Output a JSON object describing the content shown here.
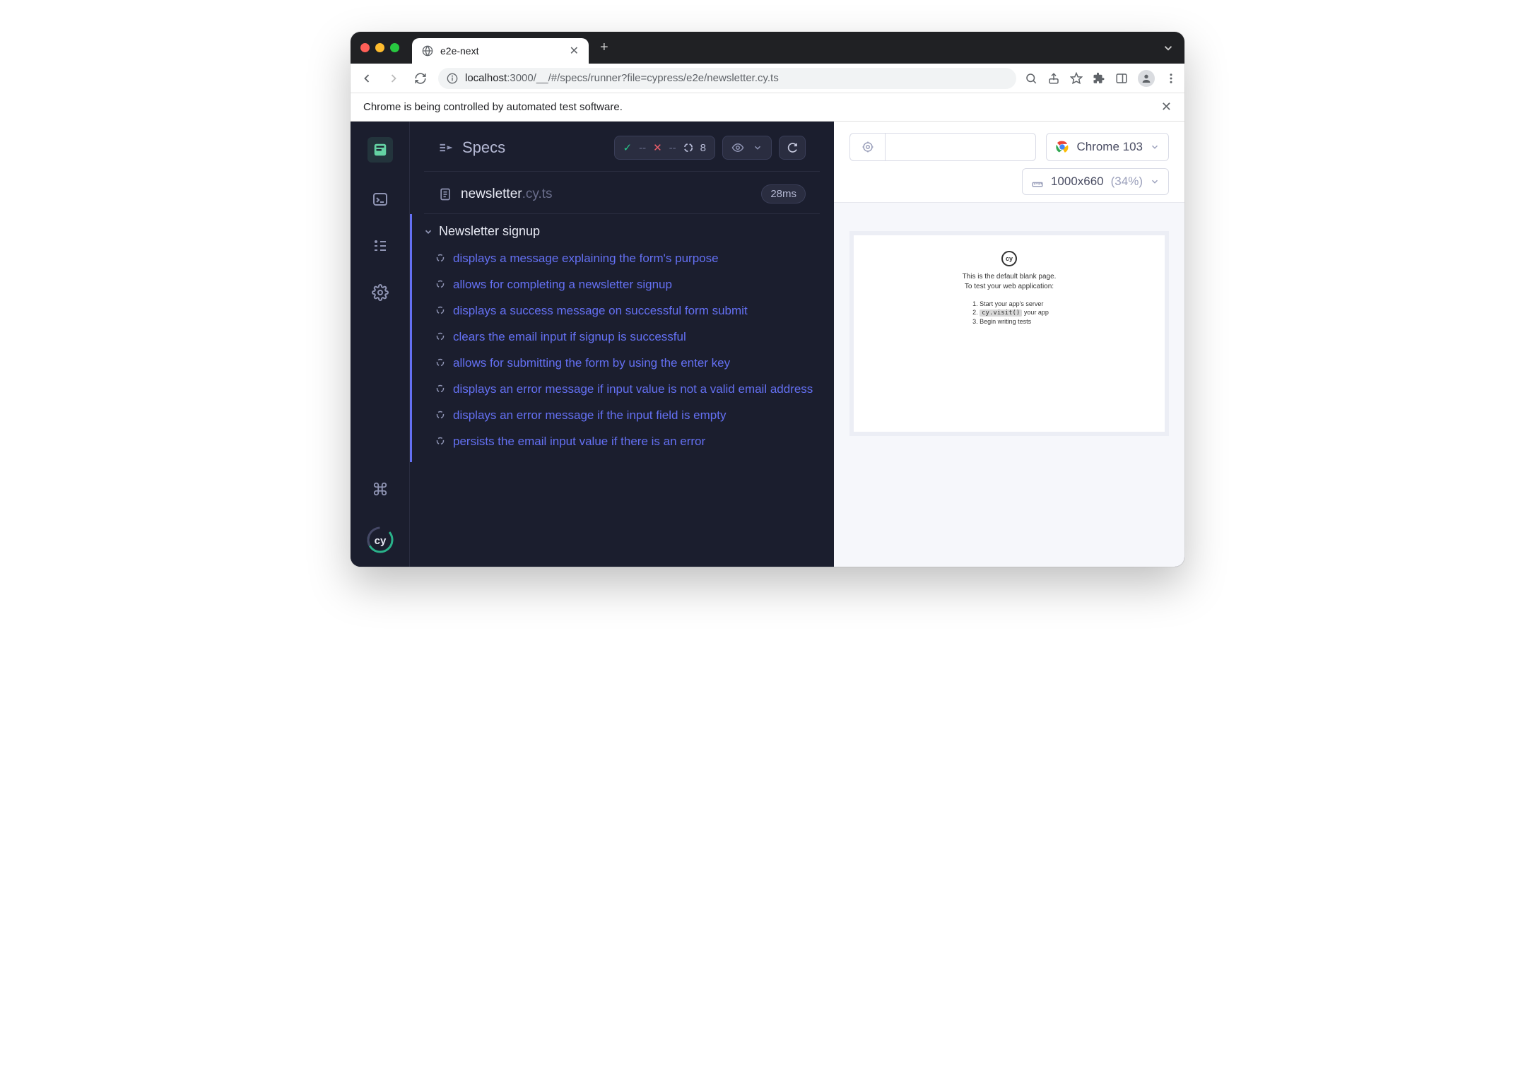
{
  "browser": {
    "tab_title": "e2e-next",
    "url_host": "localhost",
    "url_path": ":3000/__/#/specs/runner?file=cypress/e2e/newsletter.cy.ts",
    "automation_banner": "Chrome is being controlled by automated test software."
  },
  "reporter": {
    "header_title": "Specs",
    "stats": {
      "pass": "--",
      "fail": "--",
      "pending": "8"
    },
    "spec": {
      "name": "newsletter",
      "ext": ".cy.ts",
      "duration": "28ms"
    },
    "suite": {
      "title": "Newsletter signup",
      "tests": [
        "displays a message explaining the form's purpose",
        "allows for completing a newsletter signup",
        "displays a success message on successful form submit",
        "clears the email input if signup is successful",
        "allows for submitting the form by using the enter key",
        "displays an error message if input value is not a valid email address",
        "displays an error message if the input field is empty",
        "persists the email input value if there is an error"
      ]
    }
  },
  "aut": {
    "browser_label": "Chrome 103",
    "viewport": "1000x660",
    "scale": "(34%)",
    "blank": {
      "line1": "This is the default blank page.",
      "line2": "To test your web application:",
      "steps": [
        "Start your app's server",
        "cy.visit() your app",
        "Begin writing tests"
      ]
    }
  }
}
